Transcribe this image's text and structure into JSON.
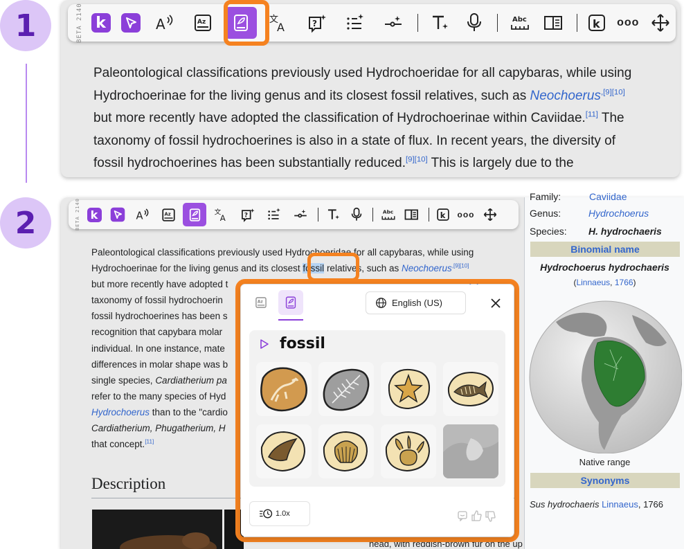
{
  "steps": {
    "one": "1",
    "two": "2"
  },
  "toolbar": {
    "beta_label": "BETA",
    "build_label": "2140",
    "spell_icon_text": "Abc",
    "more_label": "ooo"
  },
  "top_paragraph": {
    "l1": "Paleontological classifications previously used Hydrochoeridae for all capybaras, while using",
    "l2a": "Hydrochoerinae for the living genus and its closest fossil relatives, such as ",
    "l2_link": "Neochoerus",
    "l2_ref": ",[9][10]",
    "l3a": "but more recently have adopted the classification of Hydrochoerinae within Caviidae.",
    "l3_ref": "[11]",
    "l3b": " The",
    "l4": "taxonomy of fossil hydrochoerines is also in a state of flux. In recent years, the diversity of",
    "l5a": "fossil hydrochoerines has been substantially reduced.",
    "l5_ref": "[9][10]",
    "l5b": " This is largely due to the"
  },
  "article": {
    "l1": "Paleontological classifications previously used Hydrochoeridae for all capybaras, while using",
    "l2a": "Hydrochoerinae for the living genus and its closest ",
    "l2_selected": "fossil",
    "l2b": " relatives, such as ",
    "l2_link": "Neochoerus",
    "l2_ref": ",[9][10]",
    "l3": "but more recently have adopted t",
    "l3_ref": "[11]",
    "l4": "taxonomy of fossil hydrochoerin",
    "l5": "fossil hydrochoerines has been s",
    "l6": "recognition that capybara molar",
    "l7": "individual. In one instance, mate",
    "l8": "differences in molar shape was b",
    "l9a": "single species, ",
    "l9_it": "Cardiatherium pa",
    "l10": "refer to the many species of Hyd",
    "l11a": "Hydrochoerus",
    "l11b": " than to the \"cardio",
    "l12a": "Cardiatherium, Phugatherium, H",
    "l13a": "that concept.",
    "l13_ref": "[11]",
    "section_heading": "Description",
    "bottom_cut": "head, with reddish-brown fur on the upper part of its body that turns"
  },
  "infobox": {
    "family_label": "Family:",
    "family_value": "Caviidae",
    "genus_label": "Genus:",
    "genus_value": "Hydrochoerus",
    "species_label": "Species:",
    "species_value": "H. hydrochaeris",
    "binomial_header": "Binomial name",
    "binomial_value": "Hydrochoerus hydrochaeris",
    "authority_open": "(",
    "authority_link": "Linnaeus",
    "authority_sep": ", ",
    "authority_year": "1766",
    "authority_close": ")",
    "map_caption": "Native range",
    "synonyms_header": "Synonyms",
    "synonym_italic": "Sus hydrochaeris",
    "synonym_author": "Linnaeus",
    "synonym_year": ", 1766"
  },
  "popup": {
    "language": "English (US)",
    "word": "fossil",
    "speed": "1.0x"
  },
  "colors": {
    "accent_purple": "#8b3fd9",
    "highlight_orange": "#f58220",
    "link_blue": "#3366cc",
    "map_green": "#2e7d32"
  }
}
